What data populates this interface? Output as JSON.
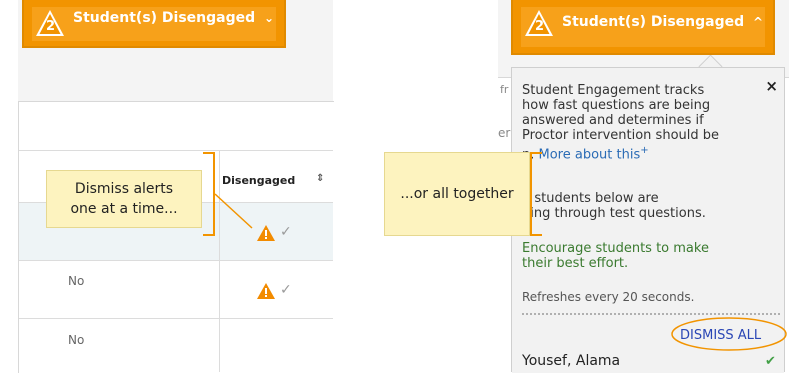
{
  "left": {
    "banner": {
      "count": "2",
      "label": "Student(s) Disengaged",
      "chevron": "⌄"
    },
    "column_header": "Disengaged",
    "sort_icon": "⇕",
    "rows": [
      {
        "value": ""
      },
      {
        "value": "No"
      },
      {
        "value": "No"
      }
    ],
    "callout": {
      "line1": "Dismiss alerts",
      "line2": "one at a time..."
    }
  },
  "right": {
    "banner": {
      "count": "2",
      "label": "Student(s) Disengaged",
      "chevron": "^"
    },
    "callout": {
      "text": "...or all together"
    },
    "bg_fragments": {
      "f": "fr",
      "e": "er"
    },
    "popup": {
      "close": "×",
      "para1_lines": [
        "Student Engagement tracks",
        "how fast questions are being",
        "answered and determines if",
        "Proctor intervention should be"
      ],
      "para1_tail": "n.",
      "more_link": "More about this",
      "plus": "+",
      "para2_lines": [
        "2 students below are",
        "ping through test questions."
      ],
      "encourage_lines": [
        "Encourage students to make",
        "their best effort."
      ],
      "refresh": "Refreshes every 20 seconds.",
      "dismiss_all": "DISMISS ALL",
      "student_name": "Yousef, Alama",
      "check": "✔"
    }
  },
  "colors": {
    "banner_orange": "#f29400",
    "callout_yellow": "#fdf3bf",
    "link_blue": "#2a6bb5",
    "dismiss_blue": "#2a46b5",
    "green_text": "#3a7a2f",
    "check_green": "#43a047",
    "warning_orange": "#f28b00"
  },
  "icons": {
    "warning": "warning-triangle-icon",
    "check": "check-icon",
    "close": "close-icon",
    "sort": "sort-icon"
  }
}
